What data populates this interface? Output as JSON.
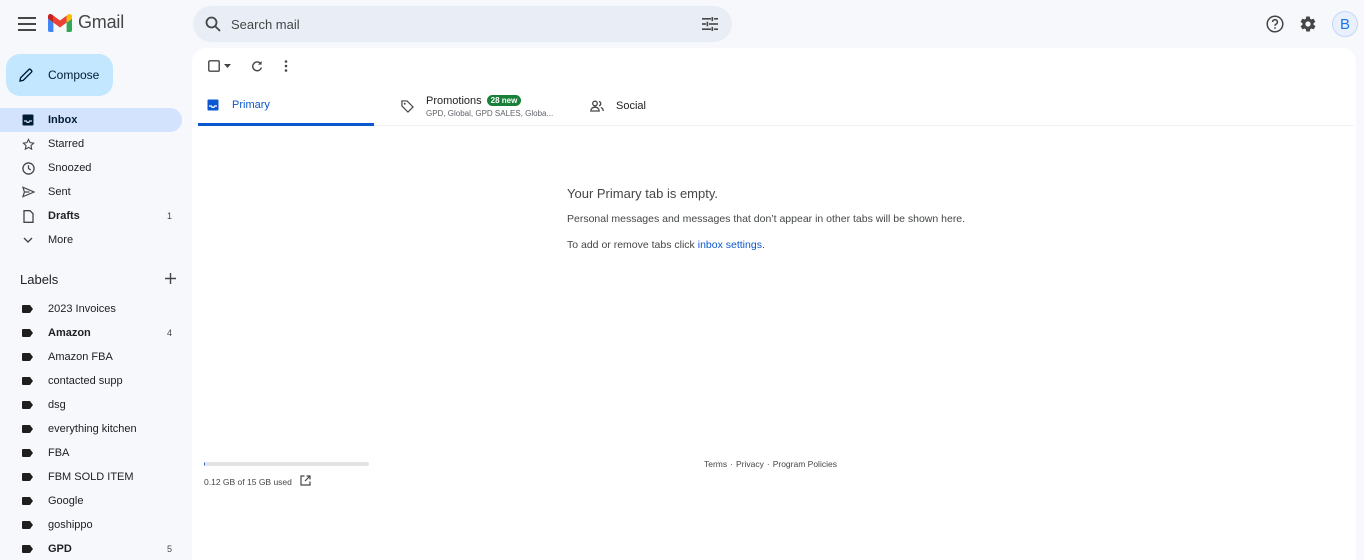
{
  "header": {
    "logo_text": "Gmail",
    "search_placeholder": "Search mail",
    "avatar_letter": "B"
  },
  "sidebar": {
    "compose_label": "Compose",
    "items": [
      {
        "label": "Inbox",
        "count": "",
        "icon": "inbox-icon"
      },
      {
        "label": "Starred",
        "count": "",
        "icon": "star-icon"
      },
      {
        "label": "Snoozed",
        "count": "",
        "icon": "clock-icon"
      },
      {
        "label": "Sent",
        "count": "",
        "icon": "send-icon"
      },
      {
        "label": "Drafts",
        "count": "1",
        "icon": "draft-icon"
      },
      {
        "label": "More",
        "count": "",
        "icon": "chevron-down-icon"
      }
    ],
    "labels_title": "Labels",
    "labels": [
      {
        "label": "2023 Invoices",
        "count": ""
      },
      {
        "label": "Amazon",
        "count": "4"
      },
      {
        "label": "Amazon FBA",
        "count": ""
      },
      {
        "label": "contacted supp",
        "count": ""
      },
      {
        "label": "dsg",
        "count": ""
      },
      {
        "label": "everything kitchen",
        "count": ""
      },
      {
        "label": "FBA",
        "count": ""
      },
      {
        "label": "FBM SOLD ITEM",
        "count": ""
      },
      {
        "label": "Google",
        "count": ""
      },
      {
        "label": "goshippo",
        "count": ""
      },
      {
        "label": "GPD",
        "count": "5"
      }
    ]
  },
  "tabs": {
    "primary": "Primary",
    "promotions": "Promotions",
    "promotions_badge": "28 new",
    "promotions_senders": "GPD, Global, GPD SALES, Globa...",
    "social": "Social"
  },
  "empty_state": {
    "title": "Your Primary tab is empty.",
    "line1": "Personal messages and messages that don’t appear in other tabs will be shown here.",
    "line2_prefix": "To add or remove tabs click ",
    "line2_link": "inbox settings",
    "line2_suffix": "."
  },
  "storage": {
    "text": "0.12 GB of 15 GB used",
    "used_fraction": 0.008
  },
  "footer": {
    "terms": "Terms",
    "privacy": "Privacy",
    "policies": "Program Policies",
    "separator": "·"
  },
  "colors": {
    "accent": "#0b57d0",
    "compose_bg": "#c2e7ff",
    "active_nav_bg": "#d3e3fd",
    "badge_green": "#188038"
  }
}
